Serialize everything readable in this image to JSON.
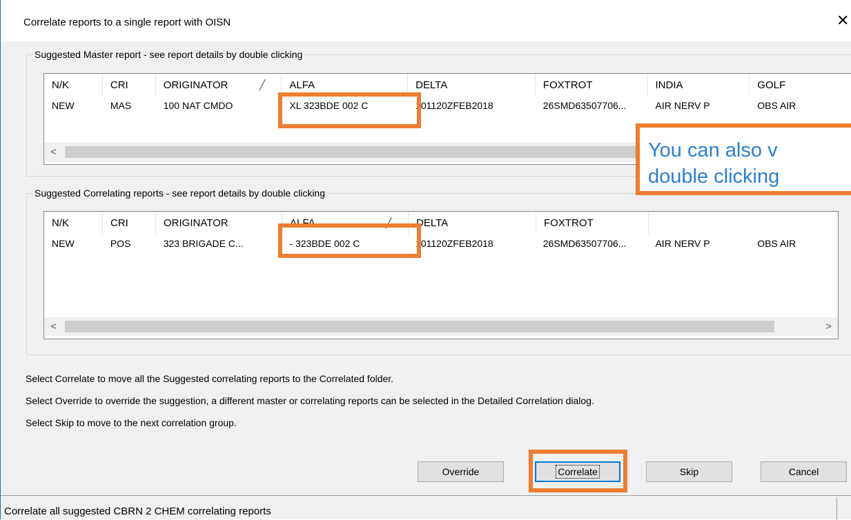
{
  "dialog": {
    "title": "Correlate reports to a single report with OISN",
    "close_glyph": "✕"
  },
  "master": {
    "legend": "Suggested Master report - see report details by double clicking",
    "columns": [
      "N/K",
      "CRI",
      "ORIGINATOR",
      "ALFA",
      "DELTA",
      "FOXTROT",
      "INDIA",
      "GOLF"
    ],
    "sort_glyph": "╱",
    "row": [
      "NEW",
      "MAS",
      "100 NAT CMDO",
      "XL 323BDE 002 C",
      "101120ZFEB2018",
      "26SMD63507706...",
      "AIR NERV P",
      "OBS AIR"
    ],
    "scroll_left": "<"
  },
  "correlating": {
    "legend": "Suggested Correlating reports - see report details  by double clicking",
    "columns": [
      "N/K",
      "CRI",
      "ORIGINATOR",
      "ALFA",
      "DELTA",
      "FOXTROT"
    ],
    "sort_glyph": "╱",
    "row": [
      "NEW",
      "POS",
      "323  BRIGADE C...",
      "- 323BDE 002 C",
      "101120ZFEB2018",
      "26SMD63507706...",
      "AIR NERV P",
      "OBS AIR"
    ],
    "scroll_left": "<",
    "scroll_right": ">"
  },
  "callout": {
    "text": "You can also v\ndouble clicking"
  },
  "instructions": [
    "Select Correlate to move all the Suggested correlating reports to the Correlated folder.",
    "Select Override to override the suggestion, a different master or correlating reports can be selected in the Detailed Correlation dialog.",
    "Select Skip to move to the next correlation group."
  ],
  "buttons": {
    "override": "Override",
    "correlate": "Correlate",
    "skip": "Skip",
    "cancel": "Cancel"
  },
  "status": {
    "text": "Correlate all suggested CBRN 2 CHEM correlating reports"
  },
  "colors": {
    "highlight": "#ee7d31",
    "callout_text": "#2c7fd0",
    "window_border": "#1c6fb5"
  }
}
